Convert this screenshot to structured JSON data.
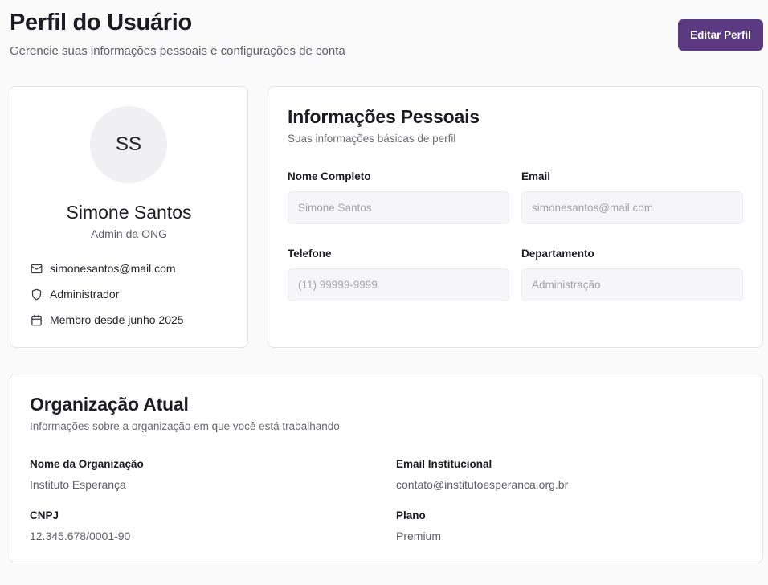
{
  "header": {
    "title": "Perfil do Usuário",
    "subtitle": "Gerencie suas informações pessoais e configurações de conta",
    "edit_button": "Editar Perfil"
  },
  "profile": {
    "initials": "SS",
    "name": "Simone Santos",
    "role": "Admin da ONG",
    "email": "simonesantos@mail.com",
    "access_level": "Administrador",
    "member_since": "Membro desde junho 2025",
    "icons": [
      "mail-icon",
      "shield-icon",
      "calendar-icon"
    ]
  },
  "personal_info": {
    "title": "Informações Pessoais",
    "subtitle": "Suas informações básicas de perfil",
    "fields": [
      {
        "label": "Nome Completo",
        "value": "",
        "placeholder": "Simone Santos"
      },
      {
        "label": "Email",
        "value": "",
        "placeholder": "simonesantos@mail.com"
      },
      {
        "label": "Telefone",
        "value": "",
        "placeholder": "(11) 99999-9999"
      },
      {
        "label": "Departamento",
        "value": "",
        "placeholder": "Administração"
      }
    ]
  },
  "organization": {
    "title": "Organização Atual",
    "subtitle": "Informações sobre a organização em que você está trabalhando",
    "fields": [
      {
        "label": "Nome da Organização",
        "value": "Instituto Esperança"
      },
      {
        "label": "Email Institucional",
        "value": "contato@institutoesperanca.org.br"
      },
      {
        "label": "CNPJ",
        "value": "12.345.678/0001-90"
      },
      {
        "label": "Plano",
        "value": "Premium"
      }
    ]
  },
  "colors": {
    "accent": "#5b3a82",
    "background": "#fafafa",
    "card_border": "#e3e3e8",
    "muted_text": "#5f5f69"
  }
}
